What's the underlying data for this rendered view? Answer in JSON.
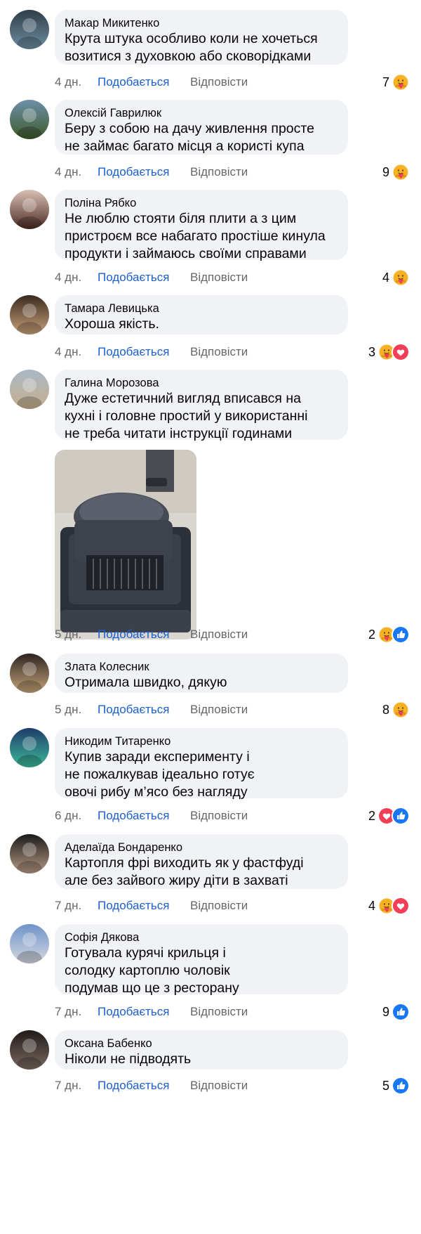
{
  "actions": {
    "like": "Подобається",
    "reply": "Відповісти"
  },
  "colors": {
    "link": "#1a5fd0",
    "bubble": "#f0f2f5",
    "meta": "#65676b",
    "haha": "#f7b125",
    "love": "#f33e58",
    "like": "#1877f2"
  },
  "comments": [
    {
      "author": "Макар Микитенко",
      "lines": [
        "Крута штука особливо коли не хочеться",
        "возитися з духовкою або сковорідками"
      ],
      "time": "4 дн.",
      "count": "7",
      "reactions": [
        "care-icon"
      ]
    },
    {
      "author": "Олексій Гаврилюк",
      "lines": [
        "Беру з собою на дачу живлення просте",
        "не займає багато місця а користі купа"
      ],
      "time": "4 дн.",
      "count": "9",
      "reactions": [
        "care-icon"
      ]
    },
    {
      "author": "Поліна Рябко",
      "lines": [
        "Не люблю стояти біля плити а з цим",
        "пристроєм все набагато простіше кинула",
        "продукти і займаюсь своїми справами"
      ],
      "time": "4 дн.",
      "count": "4",
      "reactions": [
        "care-icon"
      ]
    },
    {
      "author": "Тамара Левицька",
      "lines": [
        "Хороша якість."
      ],
      "time": "4 дн.",
      "count": "3",
      "reactions": [
        "care-icon",
        "love-icon"
      ]
    },
    {
      "author": "Галина Морозова",
      "lines": [
        "Дуже естетичний вигляд вписався на",
        "кухні і головне простий у використанні",
        "не треба читати інструкції годинами"
      ],
      "time": "5 дн.",
      "count": "2",
      "reactions": [
        "care-icon",
        "like-icon"
      ],
      "has_photo": true
    },
    {
      "author": "Злата Колесник",
      "lines": [
        "Отримала швидко, дякую"
      ],
      "time": "5 дн.",
      "count": "8",
      "reactions": [
        "care-icon"
      ]
    },
    {
      "author": "Никодим Титаренко",
      "lines": [
        "Купив заради експерименту і",
        "не пожалкував ідеально готує",
        "овочі рибу м’ясо без нагляду"
      ],
      "time": "6 дн.",
      "count": "2",
      "reactions": [
        "love-icon",
        "like-icon"
      ]
    },
    {
      "author": "Аделаїда Бондаренко",
      "lines": [
        "Картопля фрі виходить як у фастфуді",
        "але без зайвого жиру діти в захваті"
      ],
      "time": "7 дн.",
      "count": "4",
      "reactions": [
        "care-icon",
        "love-icon"
      ]
    },
    {
      "author": "Софія Дякова",
      "lines": [
        "Готувала курячі крильця і",
        "солодку картоплю чоловік",
        "подумав що це з ресторану"
      ],
      "time": "7 дн.",
      "count": "9",
      "reactions": [
        "like-icon"
      ]
    },
    {
      "author": "Оксана Бабенко",
      "lines": [
        "Ніколи не підводять"
      ],
      "time": "7 дн.",
      "count": "5",
      "reactions": [
        "like-icon"
      ]
    }
  ]
}
